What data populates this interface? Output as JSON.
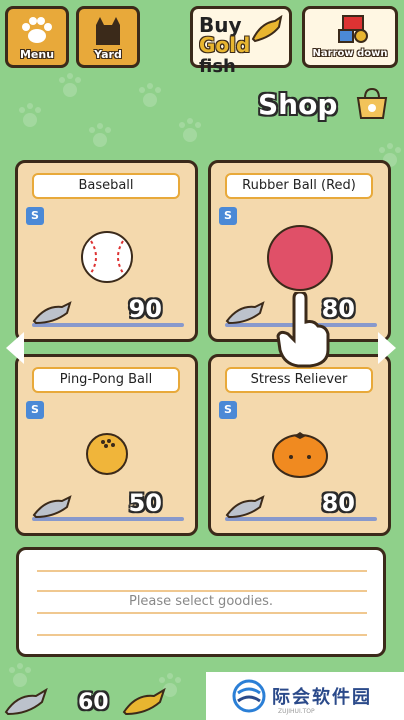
{
  "topbar": {
    "menu_label": "Menu",
    "yard_label": "Yard",
    "buy_line1": "Buy",
    "buy_gold": "Gold",
    "buy_fish": "fish",
    "narrow_label": "Narrow down"
  },
  "header": {
    "title": "Shop"
  },
  "items": [
    {
      "name": "Baseball",
      "price": "90",
      "currency_badge": "S"
    },
    {
      "name": "Rubber Ball (Red)",
      "price": "80",
      "currency_badge": "S"
    },
    {
      "name": "Ping-Pong Ball",
      "price": "50",
      "currency_badge": "S"
    },
    {
      "name": "Stress Reliever",
      "price": "80",
      "currency_badge": "S"
    }
  ],
  "message": {
    "text": "Please select goodies."
  },
  "footer": {
    "silver_fish_count": "60"
  },
  "watermark": {
    "text": "际会软件园",
    "sub": "ZUJIHUI.TOP"
  },
  "colors": {
    "background": "#8fd08a",
    "card": "#f4d9ad",
    "accent": "#e8a93a",
    "badge": "#4b89d6"
  }
}
